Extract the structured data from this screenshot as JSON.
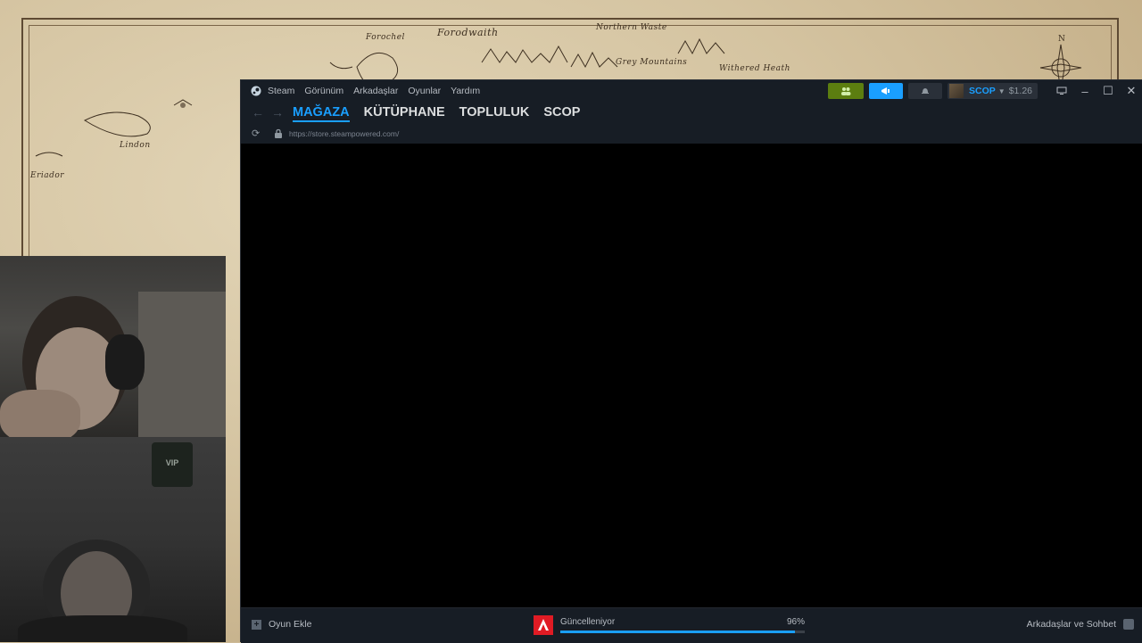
{
  "map": {
    "labels": [
      "Forodwaith",
      "Forochel",
      "Northern Waste",
      "Grey Mountains",
      "Withered Heath",
      "Lindon",
      "Eriador"
    ],
    "compass_letter": "N"
  },
  "steam": {
    "menu": [
      "Steam",
      "Görünüm",
      "Arkadaşlar",
      "Oyunlar",
      "Yardım"
    ],
    "user": {
      "name": "SCOP",
      "wallet": "$1.26"
    },
    "nav_tabs": [
      "MAĞAZA",
      "KÜTÜPHANE",
      "TOPLULUK",
      "SCOP"
    ],
    "url": "https://store.steampowered.com/",
    "bottom": {
      "add_game": "Oyun Ekle",
      "download_label": "Güncelleniyor",
      "download_percent_text": "96%",
      "download_percent": 96,
      "friends_chat": "Arkadaşlar ve Sohbet"
    },
    "colors": {
      "accent": "#1a9fff",
      "green": "#5c7e10",
      "panel": "#171d25"
    }
  },
  "cams": {
    "vip_sign": "VIP"
  }
}
